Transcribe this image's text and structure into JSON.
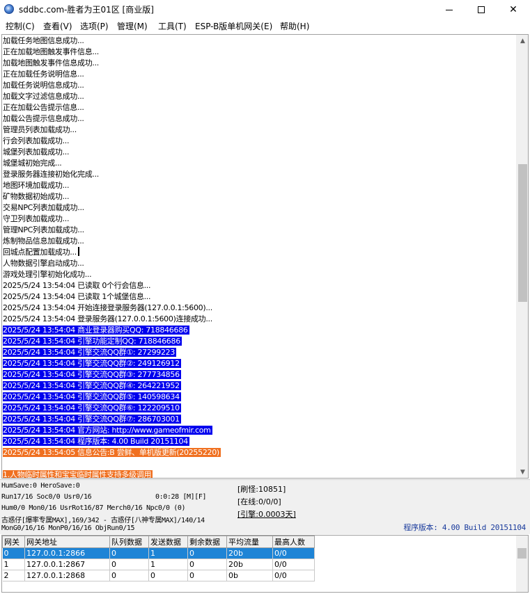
{
  "window": {
    "title": "sddbc.com-胜者为王01区 [商业版]",
    "minimize": "",
    "maximize": "",
    "close": "✕"
  },
  "menu": [
    "控制(C)",
    "查看(V)",
    "选项(P)",
    "管理(M)",
    "工具(T)",
    "ESP-B版单机网关(E)",
    "帮助(H)"
  ],
  "log": [
    {
      "text": "加载任务地图信息成功...",
      "style": "normal"
    },
    {
      "text": "正在加载地图触发事件信息...",
      "style": "normal"
    },
    {
      "text": "加载地图触发事件信息成功...",
      "style": "normal"
    },
    {
      "text": "正在加载任务说明信息...",
      "style": "normal"
    },
    {
      "text": "加载任务说明信息成功...",
      "style": "normal"
    },
    {
      "text": "加载文字过滤信息成功...",
      "style": "normal"
    },
    {
      "text": "正在加载公告提示信息...",
      "style": "normal"
    },
    {
      "text": "加载公告提示信息成功...",
      "style": "normal"
    },
    {
      "text": "管理员列表加载成功...",
      "style": "normal"
    },
    {
      "text": "行会列表加载成功...",
      "style": "normal"
    },
    {
      "text": "城堡列表加载成功...",
      "style": "normal"
    },
    {
      "text": "城堡城初始完成...",
      "style": "normal"
    },
    {
      "text": "登录服务器连接初始化完成...",
      "style": "normal"
    },
    {
      "text": "地图环境加载成功...",
      "style": "normal"
    },
    {
      "text": "矿物数据初始成功...",
      "style": "normal"
    },
    {
      "text": "交易NPC列表加载成功...",
      "style": "normal"
    },
    {
      "text": "守卫列表加载成功...",
      "style": "normal"
    },
    {
      "text": "管理NPC列表加载成功...",
      "style": "normal"
    },
    {
      "text": "炼制物品信息加载成功...",
      "style": "normal"
    },
    {
      "text": "回城点配置加载成功...",
      "style": "cursor"
    },
    {
      "text": "人物数据引擎启动成功...",
      "style": "normal"
    },
    {
      "text": "游戏处理引擎初始化成功...",
      "style": "normal"
    },
    {
      "text": "2025/5/24 13:54:04 已读取 0个行会信息...",
      "style": "normal"
    },
    {
      "text": "2025/5/24 13:54:04 已读取 1个城堡信息...",
      "style": "normal"
    },
    {
      "text": "2025/5/24 13:54:04 开始连接登录服务器(127.0.0.1:5600)...",
      "style": "normal"
    },
    {
      "text": "2025/5/24 13:54:04 登录服务器(127.0.0.1:5600)连接成功...",
      "style": "normal"
    },
    {
      "text": "2025/5/24 13:54:04 商业登录器购买QQ: 718846686",
      "style": "blue"
    },
    {
      "text": "2025/5/24 13:54:04 引擎功能定制QQ: 718846686",
      "style": "blue"
    },
    {
      "text": "2025/5/24 13:54:04 引擎交流QQ群①: 27299223",
      "style": "blue"
    },
    {
      "text": "2025/5/24 13:54:04 引擎交流QQ群②: 249126912",
      "style": "blue"
    },
    {
      "text": "2025/5/24 13:54:04 引擎交流QQ群③: 277734856",
      "style": "blue"
    },
    {
      "text": "2025/5/24 13:54:04 引擎交流QQ群④: 264221952",
      "style": "blue"
    },
    {
      "text": "2025/5/24 13:54:04 引擎交流QQ群⑤: 140598634",
      "style": "blue"
    },
    {
      "text": "2025/5/24 13:54:04 引擎交流QQ群⑥: 122209510",
      "style": "blue"
    },
    {
      "text": "2025/5/24 13:54:04 引擎交流QQ群⑦: 286703001",
      "style": "blue"
    },
    {
      "text": "2025/5/24 13:54:04 官方网站: http://www.gameofmir.com",
      "style": "blue"
    },
    {
      "text": "2025/5/24 13:54:04 程序版本: 4.00 Build 20151104",
      "style": "blue"
    },
    {
      "text": "2025/5/24 13:54:05 信息公告:B 尝鲜、单机版更新(20255220)",
      "style": "orange"
    },
    {
      "text": "",
      "style": "normal"
    },
    {
      "text": "1.人物临时属性和宝宝临时属性支持多级调用",
      "style": "orange"
    }
  ],
  "status": {
    "line1": "HumSave:0 HeroSave:0",
    "line2": "Run17/16 Soc0/0 Usr0/16",
    "timer": "0:0:28 [M][F]",
    "line3": "Hum0/0 Mon0/16 UsrRot16/87 Merch0/16 Npc0/0 (0)",
    "line4": "古惑仔[爆率专属MAX],169/342 - 古惑仔[八神专属MAX]/140/14",
    "line5": "MonG0/16/16 MonP0/16/16 ObjRun0/15",
    "refresh": "[刷怪:10851]",
    "online": "[在线:0/0/0]",
    "engine": "[引擎:0.0003天]",
    "version": "程序版本: 4.00 Build 20151104"
  },
  "gateway_table": {
    "headers": [
      "网关",
      "网关地址",
      "队列数据",
      "发送数据",
      "剩余数据",
      "平均流量",
      "最高人数"
    ],
    "rows": [
      [
        "0",
        "127.0.0.1:2866",
        "0",
        "1",
        "0",
        "20b",
        "0/0"
      ],
      [
        "1",
        "127.0.0.1:2867",
        "0",
        "1",
        "0",
        "20b",
        "0/0"
      ],
      [
        "2",
        "127.0.0.1:2868",
        "0",
        "0",
        "0",
        "0b",
        "0/0"
      ]
    ],
    "selected_row": 0
  },
  "colors": {
    "selection_blue": "#0000ee",
    "notice_orange": "#f07020",
    "grid_selection": "#1e84d6",
    "version_text": "#1a3b9c"
  },
  "icons": {
    "app": "globe-icon",
    "scroll_up": "chevron-up-icon",
    "scroll_down": "chevron-down-icon"
  }
}
